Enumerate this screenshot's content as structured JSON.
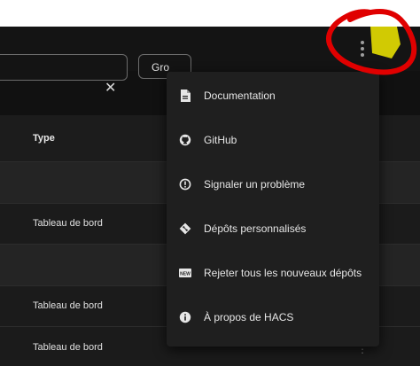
{
  "search": {
    "clear_icon": "close-icon",
    "value": ""
  },
  "filter_chip": {
    "label": "Gro"
  },
  "table": {
    "columns": {
      "type": "Type"
    },
    "rows": [
      {
        "kind": "group",
        "type": ""
      },
      {
        "kind": "item",
        "type": "Tableau de bord"
      },
      {
        "kind": "group",
        "type": ""
      },
      {
        "kind": "item",
        "type": "Tableau de bord"
      },
      {
        "kind": "item",
        "type": "Tableau de bord"
      }
    ]
  },
  "overflow_menu": {
    "icon": "more-vertical-icon",
    "items": [
      {
        "label": "Documentation",
        "icon": "document-icon"
      },
      {
        "label": "GitHub",
        "icon": "github-icon"
      },
      {
        "label": "Signaler un problème",
        "icon": "alert-circle-icon"
      },
      {
        "label": "Dépôts personnalisés",
        "icon": "git-icon"
      },
      {
        "label": "Rejeter tous les nouveaux dépôts",
        "icon": "new-badge-icon"
      },
      {
        "label": "À propos de HACS",
        "icon": "info-icon"
      }
    ]
  },
  "colors": {
    "background": "#111111",
    "menu": "#1f1f1f",
    "annotation": "#e00000",
    "highlight": "#f2ea00"
  }
}
